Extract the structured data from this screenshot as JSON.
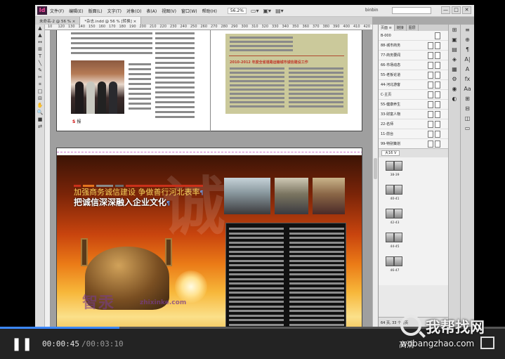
{
  "menubar": {
    "logo": "Id",
    "items": [
      "文件(F)",
      "编辑(E)",
      "版面(L)",
      "文字(T)",
      "对象(O)",
      "表(A)",
      "视图(V)",
      "窗口(W)",
      "帮助(H)"
    ],
    "zoom": "56.2%",
    "workspace": "binbin",
    "search_placeholder": "",
    "window_controls": [
      "—",
      "□",
      "✕"
    ]
  },
  "tabs": [
    {
      "label": "未命名-2 @ 56 % ×"
    },
    {
      "label": "*杂志.indd @ 56 % [转换] ×"
    }
  ],
  "ruler": [
    "10",
    "120",
    "130",
    "140",
    "150",
    "160",
    "170",
    "180",
    "190",
    "200",
    "210",
    "220",
    "230",
    "240",
    "250",
    "260",
    "270",
    "280",
    "290",
    "300",
    "310",
    "320",
    "330",
    "340",
    "350",
    "360",
    "370",
    "380",
    "390",
    "400",
    "410",
    "420"
  ],
  "tools": [
    "▲",
    "▲",
    "↔",
    "⊞",
    "T",
    "╲",
    "✎",
    "✂",
    "⌗",
    "□",
    "⊟",
    "✋",
    "🔍",
    "■",
    "⇄"
  ],
  "upper_spread": {
    "tag_red": "S",
    "tag_black": "报",
    "khaki_title": "2010-2012 年度全省道路运输城市诚信建设工作"
  },
  "lower_spread": {
    "headline1": "加强商务诚信建设 争做善行河北表率",
    "headline2": "把诚信深深融入企业文化",
    "watermark": "智汞",
    "watermark_url": "zhixinke.com",
    "big_char": "诚"
  },
  "pages_panel": {
    "tabs": [
      "页面 ≡",
      "链接",
      "图层"
    ],
    "masters": [
      "B-000",
      "88-城市商务",
      "77-商务要闻",
      "66-市场动态",
      "55-老板论道",
      "44-河北游客",
      "C-主页",
      "55-健康养生",
      "33-财富人物",
      "22-名师",
      "11-前台",
      "99-特别策划"
    ],
    "size_label": "大16 V",
    "spreads": [
      "38-39",
      "40-41",
      "42-43",
      "44-45",
      "46-47"
    ],
    "footer": "64 页, 33 个跨页"
  },
  "right_icons_a": [
    "⊞",
    "▣",
    "▤",
    "◈",
    "▦",
    "⚙",
    "◉",
    "◐"
  ],
  "right_icons_b": [
    "≡",
    "⊕",
    "¶",
    "A|",
    "A",
    "fx",
    "Aa",
    "⊞",
    "⊟",
    "◫",
    "▭"
  ],
  "player": {
    "play_icon": "pause-icon",
    "current_time": "00:00:45",
    "total_time": "/00:03:10",
    "progress": 0.237,
    "quality": "高清"
  },
  "brand": {
    "name": "我帮找网",
    "url": "wobangzhao.com"
  },
  "colors": {
    "accent": "#3c88ff",
    "headline_yellow": "#f6d35c",
    "khaki": "#cbc99b"
  }
}
